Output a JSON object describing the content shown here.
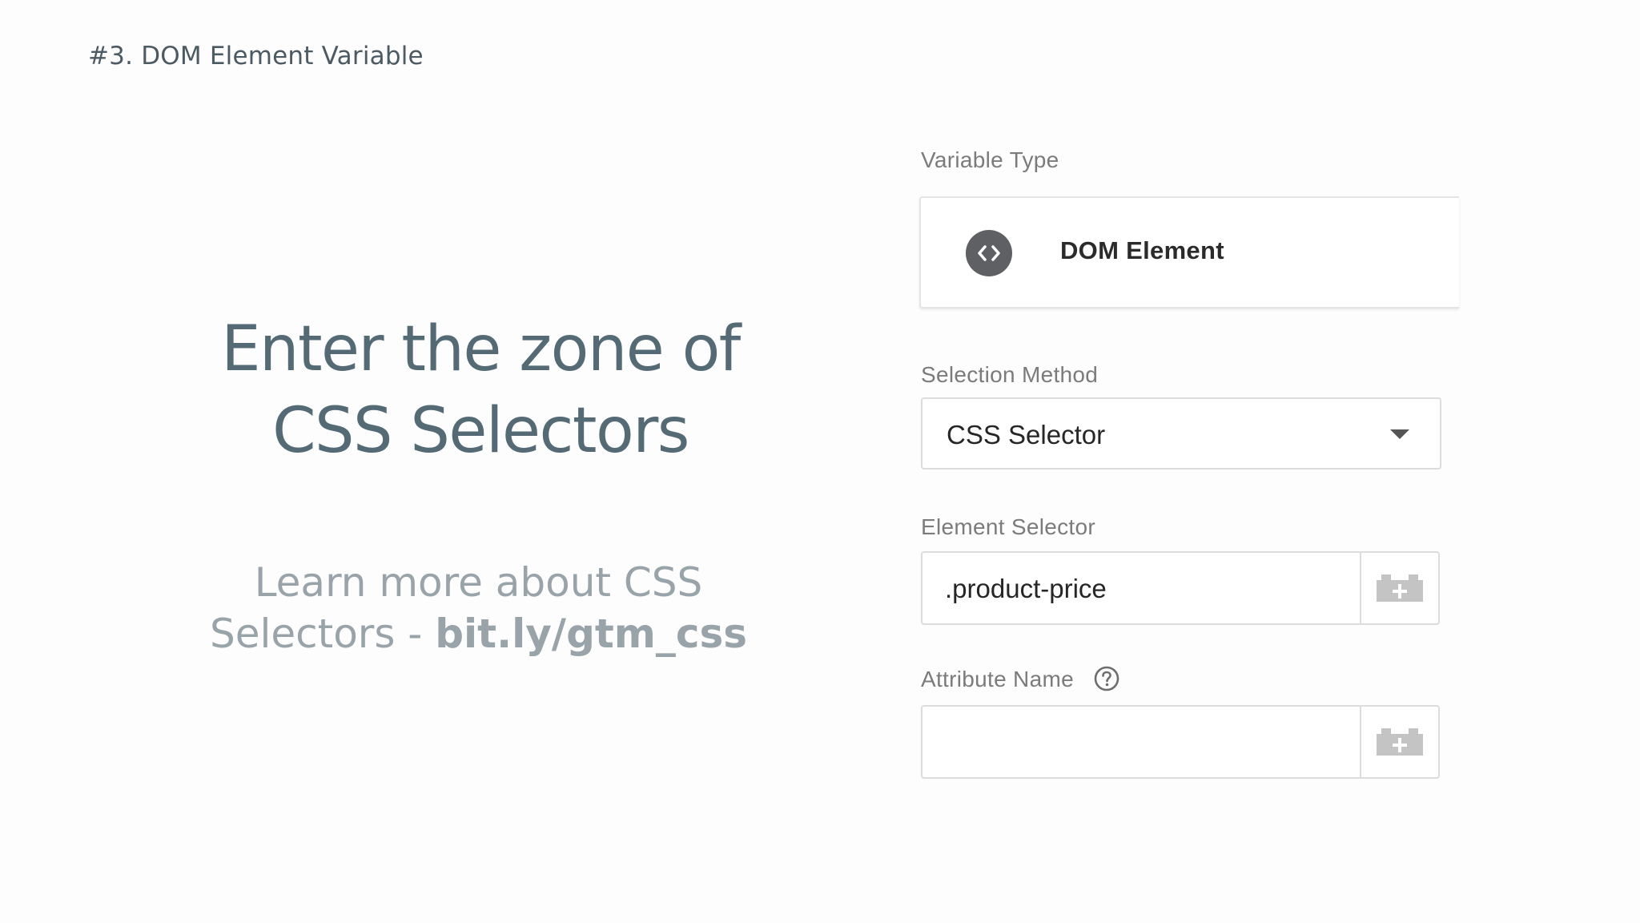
{
  "slide": {
    "section_label": "#3. DOM Element Variable",
    "headline_line1": "Enter the zone of",
    "headline_line2": "CSS Selectors",
    "learn_more_line1": "Learn more about CSS",
    "learn_more_prefix": "Selectors - ",
    "learn_more_link": "bit.ly/gtm_css"
  },
  "variable_form": {
    "variable_type_label": "Variable Type",
    "variable_type_value": "DOM Element",
    "variable_type_icon": "code-brackets-icon",
    "selection_method_label": "Selection Method",
    "selection_method_value": "CSS Selector",
    "element_selector_label": "Element Selector",
    "element_selector_value": ".product-price",
    "attribute_name_label": "Attribute Name",
    "attribute_name_value": "",
    "variable_picker_icon": "lego-brick-add-icon",
    "help_icon": "question-circle-icon"
  },
  "colors": {
    "headline": "#546b76",
    "subtext": "#98a4a9",
    "icon_circle": "#5f6063",
    "picker_icon": "#c4c4c4"
  }
}
